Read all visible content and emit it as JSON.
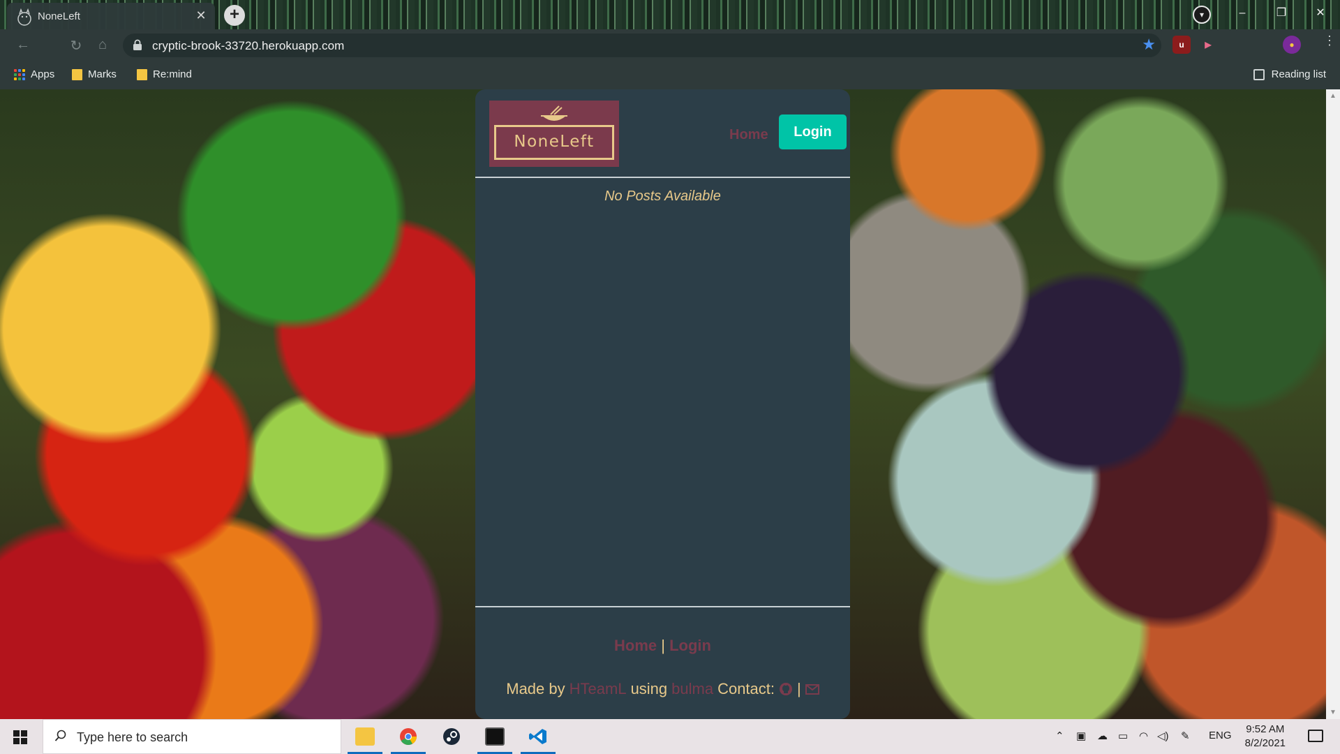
{
  "browser": {
    "tab_title": "NoneLeft",
    "tab_close": "✕",
    "new_tab": "+",
    "url": "cryptic-brook-33720.herokuapp.com",
    "window_controls": [
      "–",
      "❐",
      "✕"
    ],
    "bookmarks": [
      {
        "label": "Apps",
        "icon": "apps-grid-icon"
      },
      {
        "label": "Marks",
        "icon": "folder-icon"
      },
      {
        "label": "Re:mind",
        "icon": "folder-icon"
      }
    ],
    "reading_list": "Reading list",
    "extensions": [
      "ublock-icon",
      "extension-icon",
      "profile-avatar"
    ]
  },
  "app": {
    "logo_text": "NoneLeft",
    "nav": {
      "home": "Home",
      "login": "Login"
    },
    "empty_message": "No Posts Available",
    "footer": {
      "home": "Home",
      "separator": "|",
      "login": "Login",
      "made_by": "Made by",
      "team": "HTeamL",
      "using": "using",
      "framework": "bulma",
      "contact": "Contact:",
      "contact_separator": "|"
    },
    "colors": {
      "card": "#2c3e48",
      "accent": "#00c4a7",
      "brand": "#7a3b4d",
      "gold": "#e8c98a"
    }
  },
  "taskbar": {
    "search_placeholder": "Type here to search",
    "apps": [
      "file-explorer-icon",
      "chrome-icon",
      "steam-icon",
      "terminal-icon",
      "vscode-icon"
    ],
    "tray_language": "ENG",
    "time": "9:52 AM",
    "date": "8/2/2021"
  }
}
